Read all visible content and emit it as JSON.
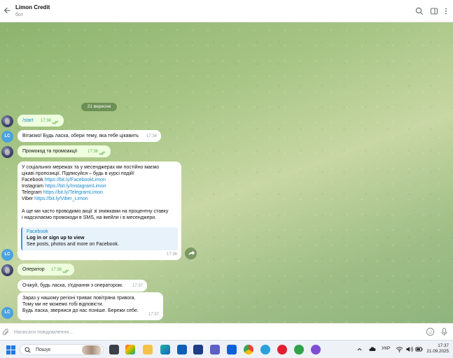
{
  "header": {
    "title": "Limon Credit",
    "subtitle": "бот"
  },
  "chat": {
    "date_divider": "21 вересня",
    "messages": [
      {
        "id": "m1",
        "text": "/start",
        "time": "17:36"
      },
      {
        "id": "m2",
        "text": "Вітаємо! Будь ласка, обери тему, яка тебе цікавить",
        "time": "17:36"
      },
      {
        "id": "m3",
        "text": "Промокод та промоакції",
        "time": "17:36"
      },
      {
        "id": "m4",
        "lines": [
          "У соціальних мережах та у месенджерах ми постійно маємо",
          "цікаві пропозиції. Підписуйся – будь в курсі подій!"
        ],
        "links": [
          {
            "label": "Facebook",
            "url": "https://bit.ly/FacebookLimon"
          },
          {
            "label": "Instagram",
            "url": "https://bit.ly/InstagramLimon"
          },
          {
            "label": "Telegram",
            "url": "https://bit.ly/TelegramLimon"
          },
          {
            "label": "Viber",
            "url": "https://bit.ly/Viber_Limon"
          }
        ],
        "lines2": [
          "А ще ми часто проводимо акції зі знижками на процентну ставку",
          "і надсилаємо промокоди в SMS, на імейли і в месенджери."
        ],
        "preview": {
          "site": "Facebook",
          "title": "Log in or sign up to view",
          "desc": "See posts, photos and more on Facebook."
        },
        "time": "17:36"
      },
      {
        "id": "m5",
        "text": "Оператор",
        "time": "17:36"
      },
      {
        "id": "m6",
        "text": "Очікуй, будь ласка, з'єднання з оператором.",
        "time": "17:37"
      },
      {
        "id": "m7",
        "lines": [
          "Зараз у нашому регіоні триває повітряна тривога.",
          "Тому ми не можемо тобі відповісти.",
          "Будь ласка, звернися до нас пізніше. Бережи себе."
        ],
        "time": "17:37"
      }
    ],
    "bot_avatar_initials": "LC"
  },
  "composer": {
    "placeholder": "Написати повідомлення..."
  },
  "taskbar": {
    "search_label": "Пошук",
    "language": "УКР",
    "time": "17:37",
    "date": "21.09.2025"
  },
  "colors": {
    "accent": "#168acd",
    "outgoing_bubble": "#eeffde",
    "check_green": "#5fae53"
  }
}
